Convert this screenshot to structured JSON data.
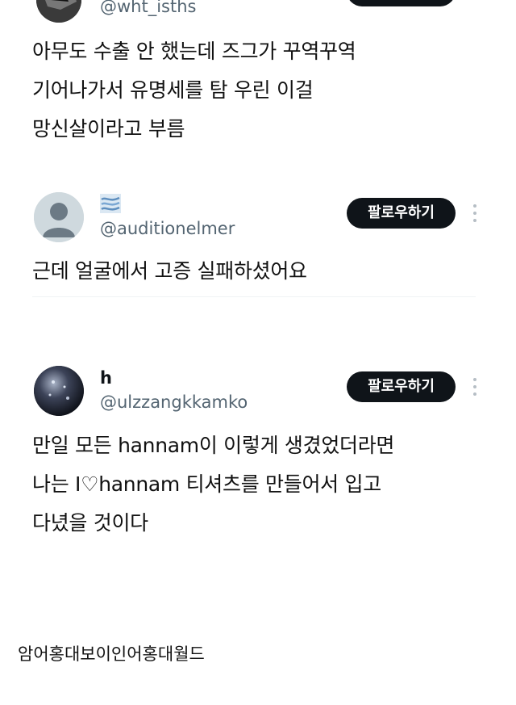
{
  "tweet1": {
    "handle": "@wht_isths",
    "lines": [
      "아무도 수출 안 했는데 즈그가 꾸역꾸역",
      "기어나가서 유명세를 탐 우린 이걸",
      "망신살이라고 부름"
    ]
  },
  "tweet2": {
    "display_name": "≋",
    "handle": "@auditionelmer",
    "follow_label": "팔로우하기",
    "lines": [
      "근데 얼굴에서 고증 실패하셨어요"
    ]
  },
  "tweet3": {
    "display_name": "h",
    "handle": "@ulzzangkkamko",
    "follow_label": "팔로우하기",
    "lines": [
      "만일 모든 hannam이 이렇게 생겼었더라면",
      "나는 I♡hannam 티셔츠를 만들어서 입고",
      "다녔을 것이다"
    ]
  },
  "footer": {
    "caption": "암어홍대보이인어홍대월드"
  }
}
